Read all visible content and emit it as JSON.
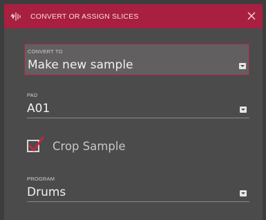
{
  "dialog": {
    "title": "CONVERT OR ASSIGN SLICES",
    "icons": {
      "title": "slice-waveform-icon",
      "close": "close-icon"
    },
    "colors": {
      "titlebar": "#a91f3f",
      "background": "#4b4b4b",
      "accent": "#b3223f"
    }
  },
  "convert_to": {
    "label": "CONVERT TO",
    "value": "Make new sample"
  },
  "pad": {
    "label": "PAD",
    "value": "A01"
  },
  "crop_sample": {
    "label": "Crop Sample",
    "checked": true
  },
  "program": {
    "label": "PROGRAM",
    "value": "Drums"
  }
}
